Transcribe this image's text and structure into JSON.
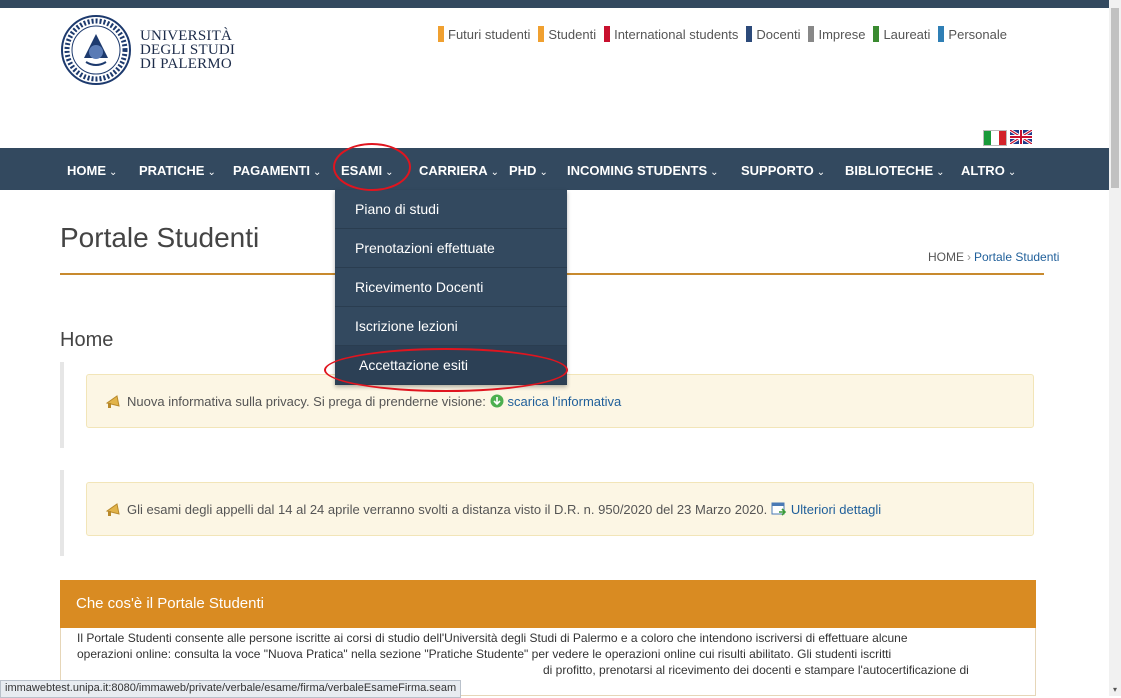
{
  "logo": {
    "line1": "UNIVERSITÀ",
    "line2": "DEGLI STUDI",
    "line3": "DI PALERMO"
  },
  "audience": [
    {
      "label": "Futuri studenti",
      "color": "#f0a030"
    },
    {
      "label": "Studenti",
      "color": "#f0a030"
    },
    {
      "label": "International students",
      "color": "#c8102e"
    },
    {
      "label": "Docenti",
      "color": "#2c4a7a"
    },
    {
      "label": "Imprese",
      "color": "#888888"
    },
    {
      "label": "Laureati",
      "color": "#3a8a30"
    },
    {
      "label": "Personale",
      "color": "#2f7fb5"
    }
  ],
  "nav": {
    "items": [
      "HOME",
      "PRATICHE",
      "PAGAMENTI",
      "ESAMI",
      "CARRIERA",
      "PHD",
      "INCOMING STUDENTS",
      "SUPPORTO",
      "BIBLIOTECHE",
      "ALTRO"
    ],
    "chevron": "⌄"
  },
  "dropdown": [
    "Piano di studi",
    "Prenotazioni effettuate",
    "Ricevimento Docenti",
    "Iscrizione lezioni",
    "Accettazione esiti"
  ],
  "page": {
    "title": "Portale Studenti",
    "breadcrumb_home": "HOME",
    "breadcrumb_sep": "›",
    "breadcrumb_current": "Portale Studenti",
    "section": "Home"
  },
  "alerts": {
    "privacy_text": "Nuova informativa sulla privacy. Si prega di prenderne visione:",
    "privacy_link": "scarica l'informativa",
    "exams_text": "Gli esami degli appelli dal 14 al 24 aprile verranno svolti a distanza visto il D.R. n. 950/2020 del 23 Marzo 2020.",
    "exams_link": "Ulteriori dettagli"
  },
  "panel": {
    "title": "Che cos'è il Portale Studenti",
    "line1": "Il Portale Studenti consente alle persone iscritte ai corsi di studio dell'Università degli Studi di Palermo e a coloro che intendono iscriversi di effettuare alcune",
    "line2": "operazioni online: consulta la voce \"Nuova Pratica\" nella sezione \"Pratiche Studente\" per vedere le operazioni online cui risulti abilitato. Gli studenti iscritti",
    "line3": "di profitto, prenotarsi al ricevimento dei docenti e stampare l'autocertificazione di"
  },
  "status_url": "immawebtest.unipa.it:8080/immaweb/private/verbale/esame/firma/verbaleEsameFirma.seam",
  "colors": {
    "nav": "#33495f",
    "accent": "#d98b22",
    "annotation": "#e0151f"
  }
}
